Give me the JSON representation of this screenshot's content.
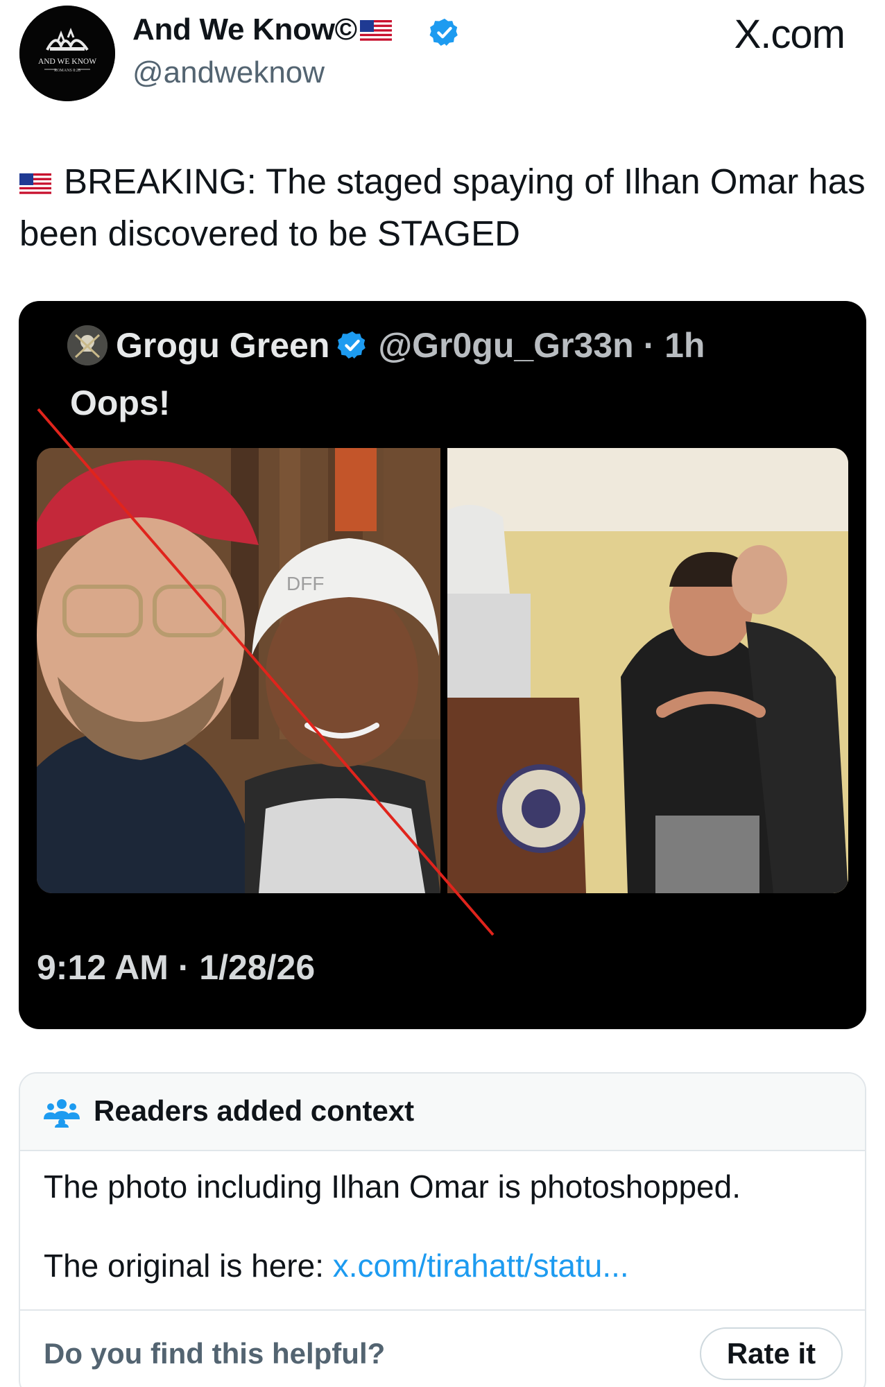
{
  "header": {
    "display_name": "And We Know©",
    "handle": "@andweknow",
    "site_label": "X.com",
    "avatar_text": "AND WE KNOW",
    "avatar_subtext": "ROMANS 8:28"
  },
  "post": {
    "text": "BREAKING: The staged spaying of Ilhan Omar has been discovered to be STAGED"
  },
  "embedded_post": {
    "display_name": "Grogu Green",
    "handle_time": "@Gr0gu_Gr33n · 1h",
    "text": "Oops!",
    "photo_caption": "DFF",
    "timestamp": "9:12 AM · 1/28/26"
  },
  "community_note": {
    "title": "Readers added context",
    "body": "The photo including Ilhan Omar is photoshopped.",
    "original_prefix": "The original is here: ",
    "original_link": "x.com/tirahatt/statu...",
    "question": "Do you find this helpful?",
    "rate_label": "Rate it"
  },
  "colors": {
    "verified_blue": "#1d9bf0",
    "link_blue": "#1d9bf0",
    "muted_text": "#536471",
    "strike_red": "#e0241c"
  },
  "icons": {
    "verified": "verified-badge-icon",
    "flag": "us-flag-icon",
    "note": "people-icon"
  }
}
